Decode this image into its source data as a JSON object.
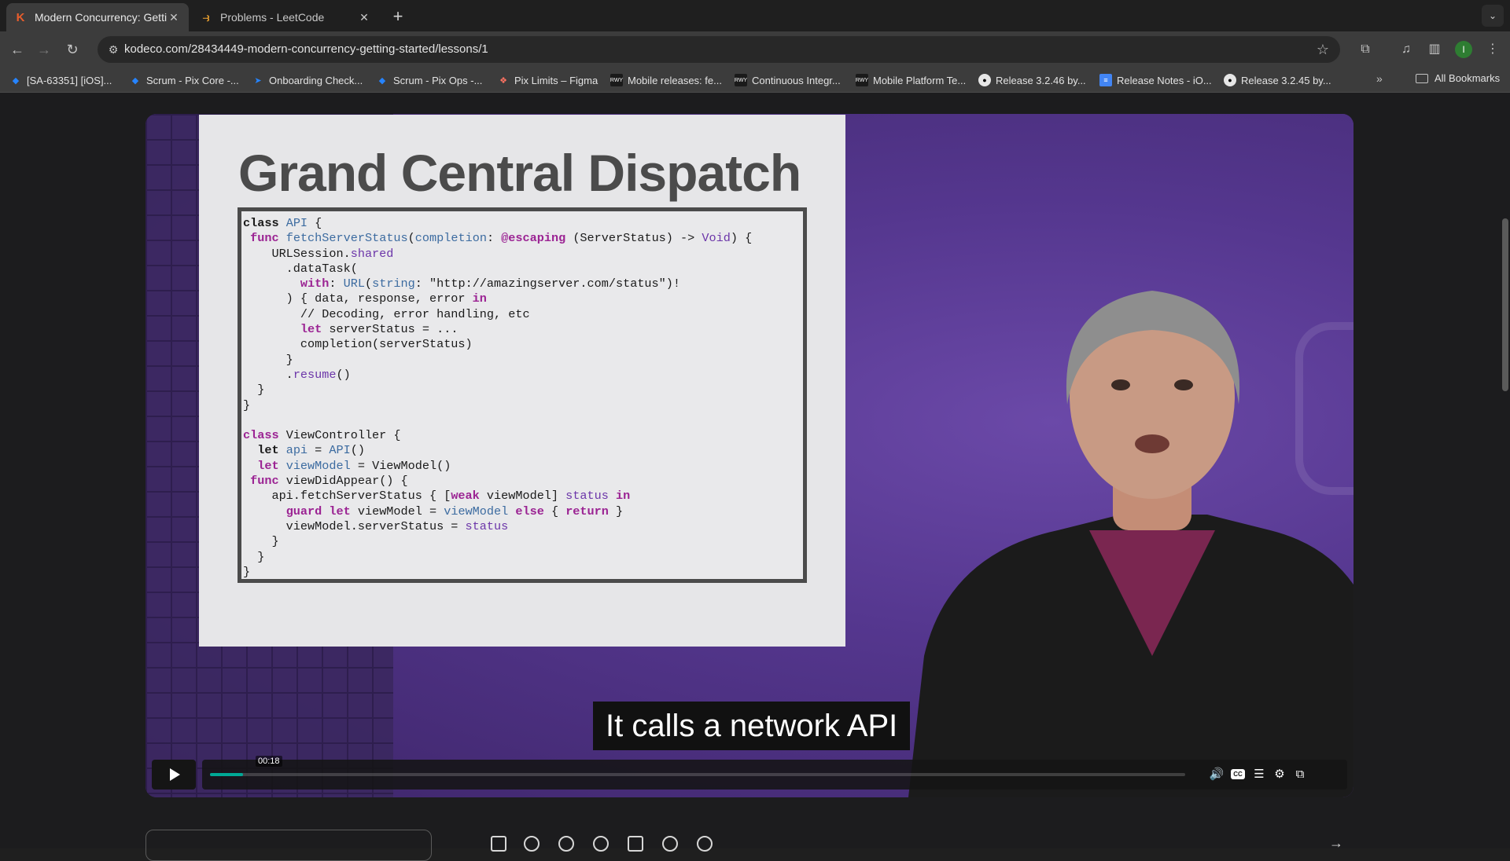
{
  "browser": {
    "tabs": [
      {
        "title": "Modern Concurrency: Getting",
        "favicon": "kodeco-logo",
        "active": true
      },
      {
        "title": "Problems - LeetCode",
        "favicon": "leetcode-logo",
        "active": false
      }
    ],
    "address_bar": {
      "url": "kodeco.com/28434449-modern-concurrency-getting-started/lessons/1"
    },
    "profile_initial": "I",
    "bookmarks": [
      {
        "label": "[SA-63351] [iOS]...",
        "icon": "jira-icon"
      },
      {
        "label": "Scrum - Pix Core -...",
        "icon": "jira-icon"
      },
      {
        "label": "Onboarding Check...",
        "icon": "jira-icon"
      },
      {
        "label": "Scrum - Pix Ops -...",
        "icon": "jira-icon"
      },
      {
        "label": "Pix Limits – Figma",
        "icon": "figma-icon"
      },
      {
        "label": "Mobile releases: fe...",
        "icon": "rwy-icon"
      },
      {
        "label": "Continuous Integr...",
        "icon": "rwy-icon"
      },
      {
        "label": "Mobile Platform Te...",
        "icon": "rwy-icon"
      },
      {
        "label": "Release 3.2.46 by...",
        "icon": "github-icon"
      },
      {
        "label": "Release Notes - iO...",
        "icon": "google-docs-icon"
      },
      {
        "label": "Release 3.2.45 by...",
        "icon": "github-icon"
      }
    ],
    "all_bookmarks_label": "All Bookmarks"
  },
  "video": {
    "slide_title": "Grand Central Dispatch",
    "caption": "It calls a network API",
    "current_time": "00:18",
    "progress_fraction": 0.034,
    "colors": {
      "progress": "#00a896",
      "background": "#55378f"
    }
  }
}
